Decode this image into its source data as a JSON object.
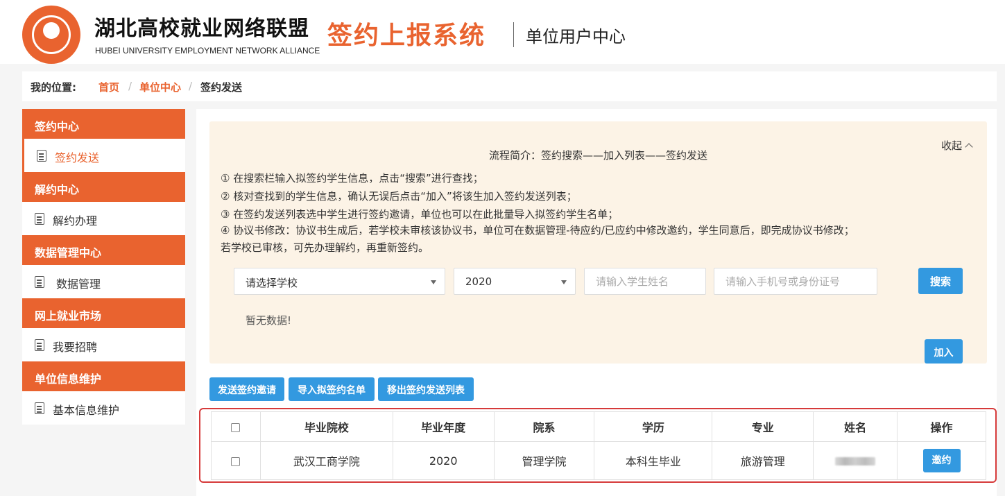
{
  "header": {
    "org_name_cn": "湖北高校就业网络联盟",
    "org_name_en": "HUBEI UNIVERSITY EMPLOYMENT NETWORK ALLIANCE",
    "system_title": "签约上报系统",
    "sub_title": "单位用户中心",
    "brand_color": "#e9632f"
  },
  "breadcrumb": {
    "label": "我的位置:",
    "items": [
      "首页",
      "单位中心",
      "签约发送"
    ],
    "separator": "/"
  },
  "sidebar": {
    "sections": [
      {
        "title": "签约中心",
        "items": [
          {
            "label": "签约发送",
            "icon": "document-icon",
            "active": true
          }
        ]
      },
      {
        "title": "解约中心",
        "items": [
          {
            "label": "解约办理",
            "icon": "document-icon"
          }
        ]
      },
      {
        "title": "数据管理中心",
        "items": [
          {
            "label": "数据管理",
            "icon": "document-icon"
          }
        ]
      },
      {
        "title": "网上就业市场",
        "items": [
          {
            "label": "我要招聘",
            "icon": "document-icon"
          }
        ]
      },
      {
        "title": "单位信息维护",
        "items": [
          {
            "label": "基本信息维护",
            "icon": "document-icon"
          }
        ]
      }
    ]
  },
  "info_panel": {
    "title": "流程简介：签约搜索——加入列表——签约发送",
    "collapse_label": "收起",
    "steps": [
      "① 在搜索栏输入拟签约学生信息，点击“搜索”进行查找；",
      "② 核对查找到的学生信息，确认无误后点击“加入”将该生加入签约发送列表；",
      "③ 在签约发送列表选中学生进行签约邀请，单位也可以在此批量导入拟签约学生名单；",
      "④ 协议书修改：协议书生成后，若学校未审核该协议书，单位可在数据管理-待应约/已应约中修改邀约，学生同意后，即完成协议书修改；",
      "若学校已审核，可先办理解约，再重新签约。"
    ]
  },
  "search": {
    "school_select": "请选择学校",
    "year_select": "2020",
    "name_placeholder": "请输入学生姓名",
    "id_placeholder": "请输入手机号或身份证号",
    "search_label": "搜索",
    "no_data": "暂无数据!",
    "add_label": "加入"
  },
  "actions": {
    "send_invite": "发送签约邀请",
    "import_list": "导入拟签约名单",
    "remove_list": "移出签约发送列表"
  },
  "table": {
    "headers": [
      "毕业院校",
      "毕业年度",
      "院系",
      "学历",
      "专业",
      "姓名",
      "操作"
    ],
    "rows": [
      {
        "school": "武汉工商学院",
        "year": "2020",
        "dept": "管理学院",
        "degree": "本科生毕业",
        "major": "旅游管理",
        "action": "邀约"
      }
    ]
  },
  "colors": {
    "accent": "#e9632f",
    "button_blue": "#3399e0",
    "info_bg": "#fcf3e6",
    "highlight_border": "#d63a3a"
  }
}
